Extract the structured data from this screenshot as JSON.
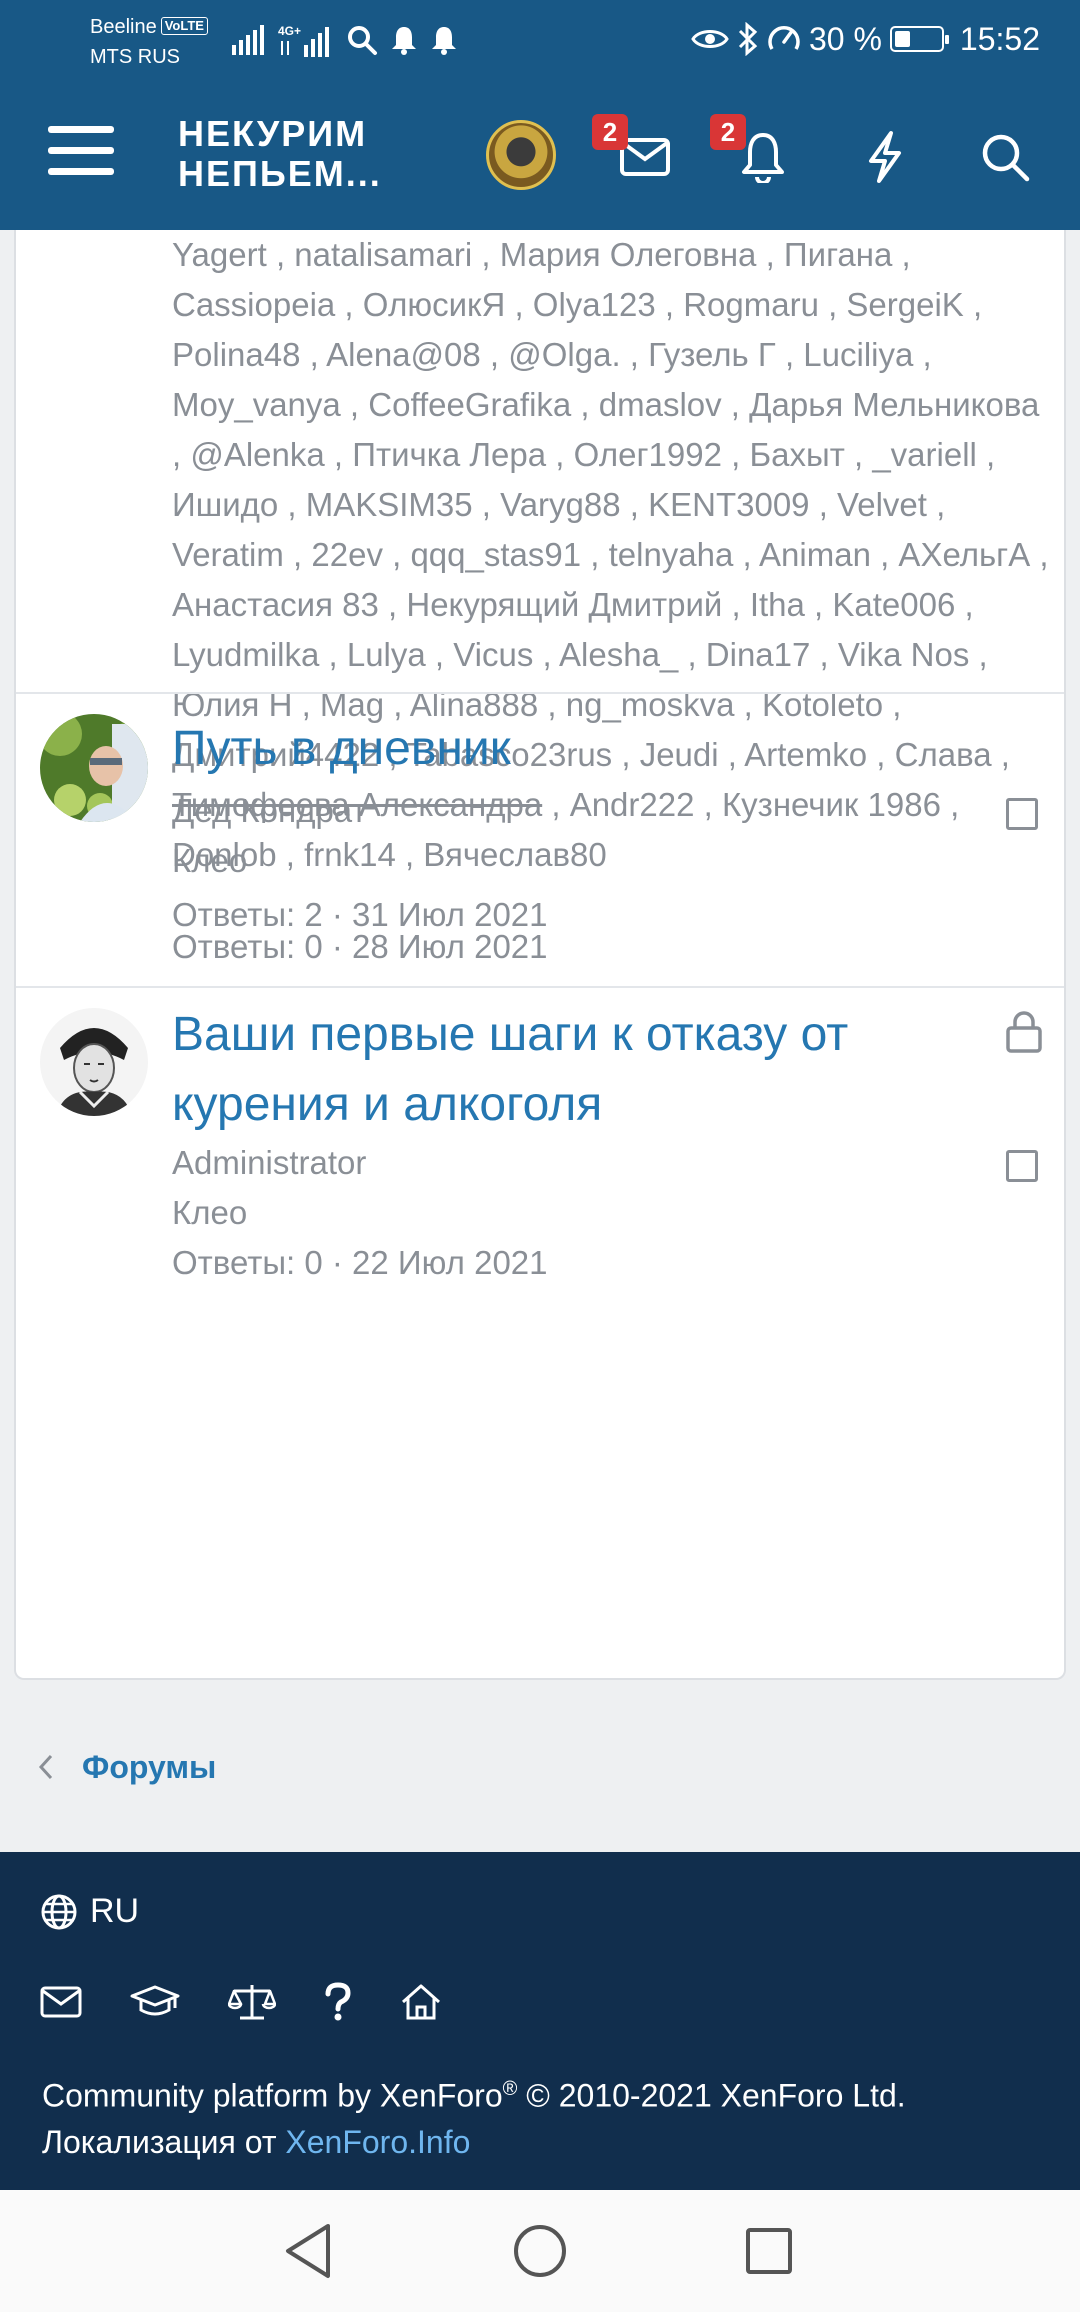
{
  "status_bar": {
    "carrier1": "Beeline",
    "volte": "VoLTE",
    "carrier2": "MTS RUS",
    "network": "4G+",
    "battery_text": "30 %",
    "battery_level": 0.3,
    "time": "15:52"
  },
  "header": {
    "logo_line1": "НЕКУРИМ",
    "logo_line2": "НЕПЬЕМ...",
    "messages_badge": "2",
    "alerts_badge": "2"
  },
  "thread_top": {
    "tags_before_strike": "Yagert , natalisamari , Мария Олеговна , Пигана , Cassiopeia , ОлюсикЯ , Olya123 , Rogmaru , SergeiK , Polina48 , Alena@08 , @Olga. , Гузель Г , Luciliya , Moy_vanya , CoffeeGrafika , dmaslov , Дарья Мельникова , @Alenka , Птичка Лера , Олег1992 , Бахыт , _variell , Ишидо , MAKSIM35 , Varyg88 , KENT3009 , Velvet , Veratim , 22ev , qqq_stas91 , telnyaha , Animan , АХельгА , Анастасия 83 , Некурящий Дмитрий , Itha , Kate006 , Lyudmilka , Lulya , Vicus , Alesha_ , Dina17 , Vika Nos , Юлия Н , Mag , Alina888 , ng_moskva , Kotoleto , Дмитрий4422 , Tabasco23rus , Jeudi , Artemko , Слава , ",
    "tag_struck": "Тимофеева Александра",
    "tags_after_strike": " , Andr222 , Кузнечик 1986 , Donlob , frnk14 , Вячеслав80",
    "meta": "Ответы: 2 · 31 Июл 2021"
  },
  "threads": [
    {
      "title": "Путь в дневник",
      "author": "Дед Кондрат",
      "forum": "Клео",
      "meta": "Ответы: 0 · 28 Июл 2021"
    },
    {
      "title": "Ваши первые шаги к отказу от курения и алкоголя",
      "author": "Administrator",
      "forum": "Клео",
      "meta": "Ответы: 0 · 22 Июл 2021"
    }
  ],
  "breadcrumb": {
    "label": "Форумы"
  },
  "footer": {
    "language": "RU",
    "copyright_prefix": "Community platform by XenForo",
    "registered": "®",
    "copyright_suffix": " © 2010-2021 XenForo Ltd.",
    "localization_prefix": "Локализация от ",
    "localization_link": "XenForo.Info"
  },
  "colors": {
    "header_bg": "#185886",
    "footer_bg": "#112e4d",
    "link": "#2577b1",
    "badge": "#d93636"
  }
}
